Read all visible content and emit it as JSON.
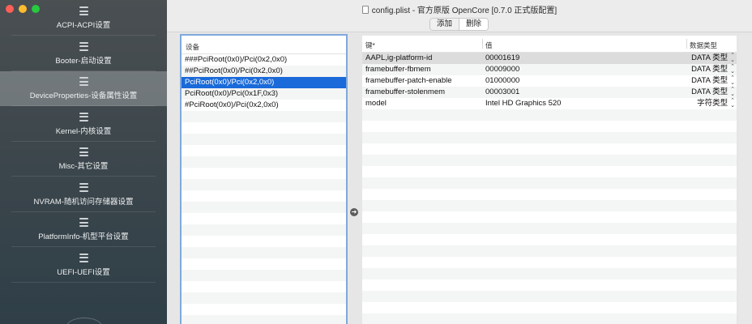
{
  "window": {
    "title": "config.plist - 官方原版 OpenCore [0.7.0 正式版配置]",
    "buttons": {
      "add": "添加",
      "delete": "删除"
    }
  },
  "sidebar": {
    "items": [
      {
        "label": "ACPI-ACPI设置",
        "icon": "list-icon"
      },
      {
        "label": "Booter-启动设置",
        "icon": "list-icon"
      },
      {
        "label": "DeviceProperties-设备属性设置",
        "icon": "list-icon",
        "active": true
      },
      {
        "label": "Kernel-内核设置",
        "icon": "list-icon"
      },
      {
        "label": "Misc-其它设置",
        "icon": "list-icon"
      },
      {
        "label": "NVRAM-随机访问存储器设置",
        "icon": "list-icon"
      },
      {
        "label": "PlatformInfo-机型平台设置",
        "icon": "list-icon"
      },
      {
        "label": "UEFI-UEFI设置",
        "icon": "list-icon"
      }
    ]
  },
  "devices": {
    "header": "设备",
    "rows": [
      "###PciRoot(0x0)/Pci(0x2,0x0)",
      "##PciRoot(0x0)/Pci(0x2,0x0)",
      "PciRoot(0x0)/Pci(0x2,0x0)",
      "PciRoot(0x0)/Pci(0x1F,0x3)",
      "#PciRoot(0x0)/Pci(0x2,0x0)"
    ],
    "selected_index": 2
  },
  "properties": {
    "headers": {
      "key": "键*",
      "value": "值",
      "type": "数据类型"
    },
    "rows": [
      {
        "key": "AAPL,ig-platform-id",
        "value": "00001619",
        "type": "DATA 类型"
      },
      {
        "key": "framebuffer-fbmem",
        "value": "00009000",
        "type": "DATA 类型"
      },
      {
        "key": "framebuffer-patch-enable",
        "value": "01000000",
        "type": "DATA 类型"
      },
      {
        "key": "framebuffer-stolenmem",
        "value": "00003001",
        "type": "DATA 类型"
      },
      {
        "key": "model",
        "value": "Intel HD Graphics 520",
        "type": "字符类型"
      }
    ]
  },
  "colors": {
    "selection": "#1a6ad9",
    "focus_border": "#7fa9dc",
    "close": "#fe5f57",
    "minimize": "#febc2e",
    "zoom": "#28c840"
  }
}
